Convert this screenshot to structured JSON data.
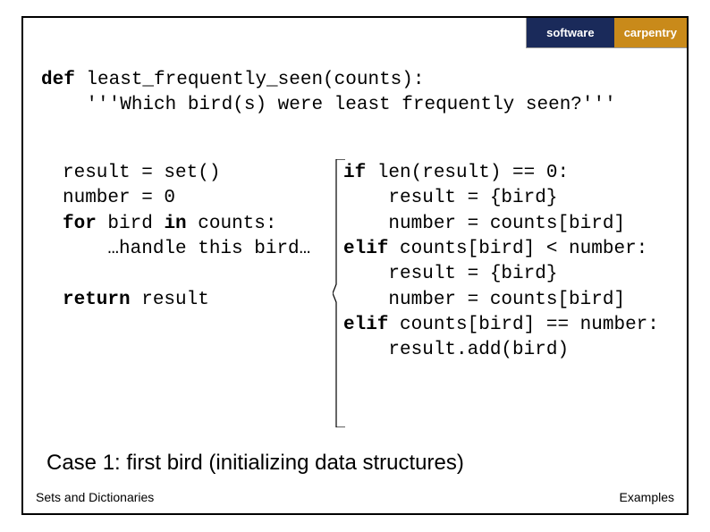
{
  "logo": {
    "left": "software",
    "right": "carpentry"
  },
  "code_top_line1_kw": "def",
  "code_top_line1_rest": " least_frequently_seen(counts):",
  "code_top_line2": "    '''Which bird(s) were least frequently seen?'''",
  "left_l1": "result = set()",
  "left_l2": "number = 0",
  "left_l3_kw1": "for",
  "left_l3_mid": " bird ",
  "left_l3_kw2": "in",
  "left_l3_rest": " counts:",
  "left_l4": "    …handle this bird…",
  "left_l5_kw": "return",
  "left_l5_rest": " result",
  "right_l1_kw": "if",
  "right_l1_rest": " len(result) == 0:",
  "right_l2": "    result = {bird}",
  "right_l3": "    number = counts[bird]",
  "right_l4_kw": "elif",
  "right_l4_rest": " counts[bird] < number:",
  "right_l5": "    result = {bird}",
  "right_l6": "    number = counts[bird]",
  "right_l7_kw": "elif",
  "right_l7_rest": " counts[bird] == number:",
  "right_l8": "    result.add(bird)",
  "caption": "Case 1: first bird (initializing data structures)",
  "footer_left": "Sets and Dictionaries",
  "footer_right": "Examples"
}
